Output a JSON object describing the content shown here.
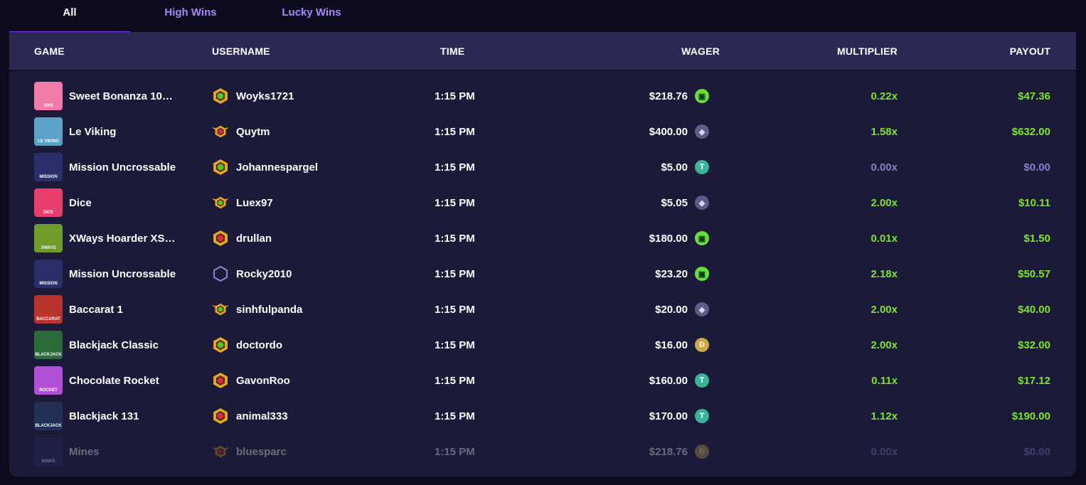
{
  "tabs": [
    "All",
    "High Wins",
    "Lucky Wins"
  ],
  "headers": {
    "game": "GAME",
    "username": "USERNAME",
    "time": "TIME",
    "wager": "WAGER",
    "multiplier": "MULTIPLIER",
    "payout": "PAYOUT"
  },
  "colors": {
    "win_green": "#7ee528",
    "zero_purple": "#8a7fcf",
    "accent": "#7c3aed"
  },
  "rows": [
    {
      "game": "Sweet Bonanza 10…",
      "thumb_label": "1000",
      "thumb_color": "#f17aa8",
      "username": "Woyks1721",
      "badge": "gold-green",
      "time": "1:15 PM",
      "wager": "$218.76",
      "currency": "cash-icon",
      "multiplier": "0.22x",
      "payout": "$47.36",
      "win": true
    },
    {
      "game": "Le Viking",
      "thumb_label": "LE VIKING",
      "thumb_color": "#5aa3c6",
      "username": "Quytm",
      "badge": "gold-winged-red",
      "time": "1:15 PM",
      "wager": "$400.00",
      "currency": "ethereum-icon",
      "multiplier": "1.58x",
      "payout": "$632.00",
      "win": true
    },
    {
      "game": "Mission Uncrossable",
      "thumb_label": "MISSION",
      "thumb_color": "#2a2f6a",
      "username": "Johannespargel",
      "badge": "gold-green",
      "time": "1:15 PM",
      "wager": "$5.00",
      "currency": "tether-icon",
      "multiplier": "0.00x",
      "payout": "$0.00",
      "win": false
    },
    {
      "game": "Dice",
      "thumb_label": "DICE",
      "thumb_color": "#e83e6b",
      "username": "Luex97",
      "badge": "gold-winged-green",
      "time": "1:15 PM",
      "wager": "$5.05",
      "currency": "ethereum-icon",
      "multiplier": "2.00x",
      "payout": "$10.11",
      "win": true
    },
    {
      "game": "XWays Hoarder XS…",
      "thumb_label": "XWAYS",
      "thumb_color": "#6f9a2c",
      "username": "drullan",
      "badge": "gold-red",
      "time": "1:15 PM",
      "wager": "$180.00",
      "currency": "cash-icon",
      "multiplier": "0.01x",
      "payout": "$1.50",
      "win": true
    },
    {
      "game": "Mission Uncrossable",
      "thumb_label": "MISSION",
      "thumb_color": "#2a2f6a",
      "username": "Rocky2010",
      "badge": "outline",
      "time": "1:15 PM",
      "wager": "$23.20",
      "currency": "cash-icon",
      "multiplier": "2.18x",
      "payout": "$50.57",
      "win": true
    },
    {
      "game": "Baccarat 1",
      "thumb_label": "BACCARAT",
      "thumb_color": "#b8332b",
      "username": "sinhfulpanda",
      "badge": "gold-winged-green",
      "time": "1:15 PM",
      "wager": "$20.00",
      "currency": "ethereum-icon",
      "multiplier": "2.00x",
      "payout": "$40.00",
      "win": true
    },
    {
      "game": "Blackjack Classic",
      "thumb_label": "BLACKJACK",
      "thumb_color": "#2e6b3a",
      "username": "doctordo",
      "badge": "gold-green",
      "time": "1:15 PM",
      "wager": "$16.00",
      "currency": "dogecoin-icon",
      "multiplier": "2.00x",
      "payout": "$32.00",
      "win": true
    },
    {
      "game": "Chocolate Rocket",
      "thumb_label": "ROCKET",
      "thumb_color": "#b24fd6",
      "username": "GavonRoo",
      "badge": "gold-red",
      "time": "1:15 PM",
      "wager": "$160.00",
      "currency": "tether-icon",
      "multiplier": "0.11x",
      "payout": "$17.12",
      "win": true
    },
    {
      "game": "Blackjack 131",
      "thumb_label": "BLACKJACK",
      "thumb_color": "#223058",
      "username": "animal333",
      "badge": "gold-red",
      "time": "1:15 PM",
      "wager": "$170.00",
      "currency": "tether-icon",
      "multiplier": "1.12x",
      "payout": "$190.00",
      "win": true
    },
    {
      "game": "Mines",
      "thumb_label": "MINES",
      "thumb_color": "#2a2f6a",
      "username": "bluesparc",
      "badge": "gold-winged-red",
      "time": "1:15 PM",
      "wager": "$218.76",
      "currency": "dogecoin-icon",
      "multiplier": "0.00x",
      "payout": "$0.00",
      "win": false,
      "faded": true
    }
  ]
}
